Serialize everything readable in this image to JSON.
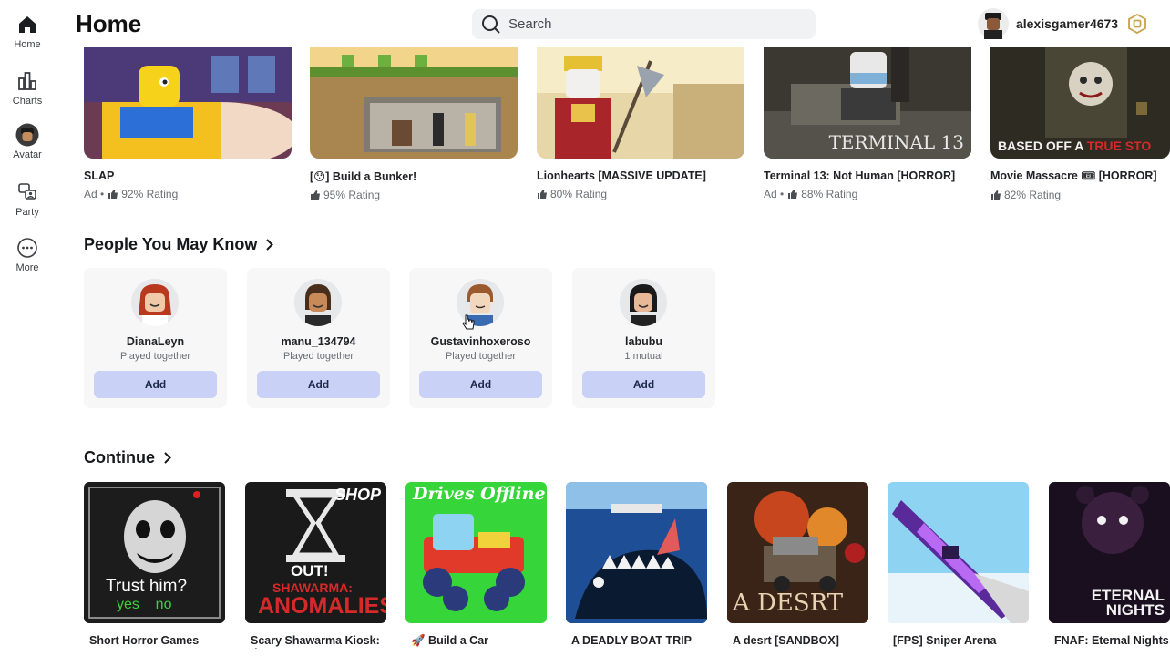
{
  "sidebar": {
    "items": [
      {
        "label": "Home",
        "icon": "home-icon"
      },
      {
        "label": "Charts",
        "icon": "charts-icon"
      },
      {
        "label": "Avatar",
        "icon": "avatar-icon"
      },
      {
        "label": "Party",
        "icon": "party-icon"
      },
      {
        "label": "More",
        "icon": "more-icon"
      }
    ]
  },
  "header": {
    "title": "Home",
    "search_placeholder": "Search",
    "username": "alexisgamer4673"
  },
  "top_games": [
    {
      "name": "SLAP",
      "meta_prefix": "Ad •",
      "rating": "92% Rating"
    },
    {
      "name": "[😯] Build a Bunker!",
      "meta_prefix": "",
      "rating": "95% Rating"
    },
    {
      "name": "Lionhearts [MASSIVE UPDATE]",
      "meta_prefix": "",
      "rating": "80% Rating"
    },
    {
      "name": "Terminal 13: Not Human [HORROR]",
      "meta_prefix": "Ad •",
      "rating": "88% Rating",
      "thumb_text": "TERMINAL 13"
    },
    {
      "name": "Movie Massacre 🎟 [HORROR]",
      "meta_prefix": "",
      "rating": "82% Rating",
      "thumb_text": "BASED OFF A",
      "thumb_text_red": "TRUE STO"
    }
  ],
  "people_section": {
    "title": "People You May Know"
  },
  "people": [
    {
      "name": "DianaLeyn",
      "subtitle": "Played together",
      "button": "Add"
    },
    {
      "name": "manu_134794",
      "subtitle": "Played together",
      "button": "Add"
    },
    {
      "name": "Gustavinhoxeroso",
      "subtitle": "Played together",
      "button": "Add"
    },
    {
      "name": "labubu",
      "subtitle": "1 mutual",
      "button": "Add"
    }
  ],
  "continue_section": {
    "title": "Continue"
  },
  "continue_games": [
    {
      "name": "Short Horror Games",
      "thumb_text": "Trust him?",
      "thumb_text2": "yes    no"
    },
    {
      "name": "Scary Shawarma Kiosk: the ANOMALY",
      "thumb_text": "SHAWARMA:",
      "thumb_text2": "ANOMALIES",
      "thumb_badge": "SHOP",
      "thumb_badge2": "OUT!"
    },
    {
      "name": "🚀 Build a Car",
      "thumb_text": "Drives Offline!"
    },
    {
      "name": "A DEADLY BOAT TRIP"
    },
    {
      "name": "A desrt [SANDBOX]",
      "thumb_text": "A DESRT"
    },
    {
      "name": "[FPS] Sniper Arena"
    },
    {
      "name": "FNAF: Eternal Nights 🍕",
      "thumb_text": "ETERNAL",
      "thumb_text2": "NIGHTS"
    }
  ],
  "colors": {
    "add_button": "#c9d2f6",
    "card_bg": "#f7f7f8",
    "search_bg": "#f1f2f4"
  }
}
